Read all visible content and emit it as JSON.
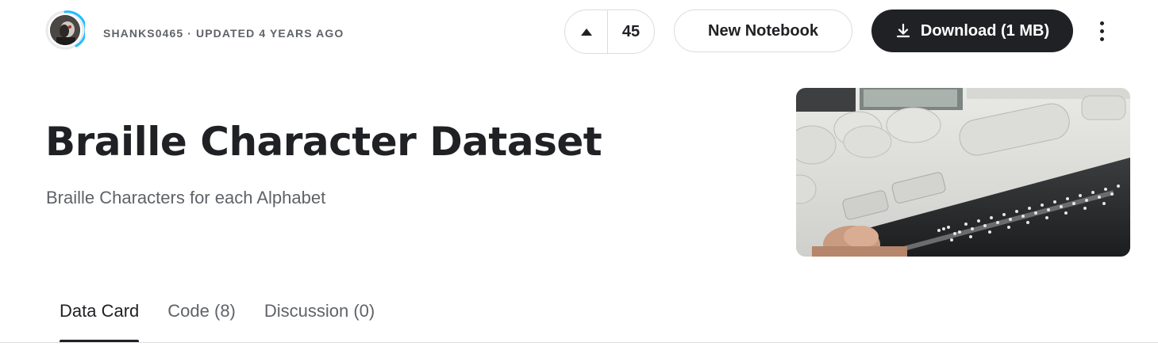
{
  "header": {
    "meta": "SHANKS0465 · UPDATED 4 YEARS AGO",
    "vote_count": "45",
    "new_notebook_label": "New Notebook",
    "download_label": "Download (1 MB)"
  },
  "dataset": {
    "title": "Braille Character Dataset",
    "subtitle": "Braille Characters for each Alphabet"
  },
  "tabs": [
    {
      "label": "Data Card",
      "active": true
    },
    {
      "label": "Code (8)",
      "active": false
    },
    {
      "label": "Discussion (0)",
      "active": false
    }
  ],
  "icons": {
    "upvote": "caret-up-icon",
    "download": "download-icon",
    "more": "more-vert-icon"
  },
  "colors": {
    "accent_ring": "#20beff",
    "primary_dark": "#202124",
    "muted_text": "#5f6368",
    "border": "#dadce0"
  }
}
